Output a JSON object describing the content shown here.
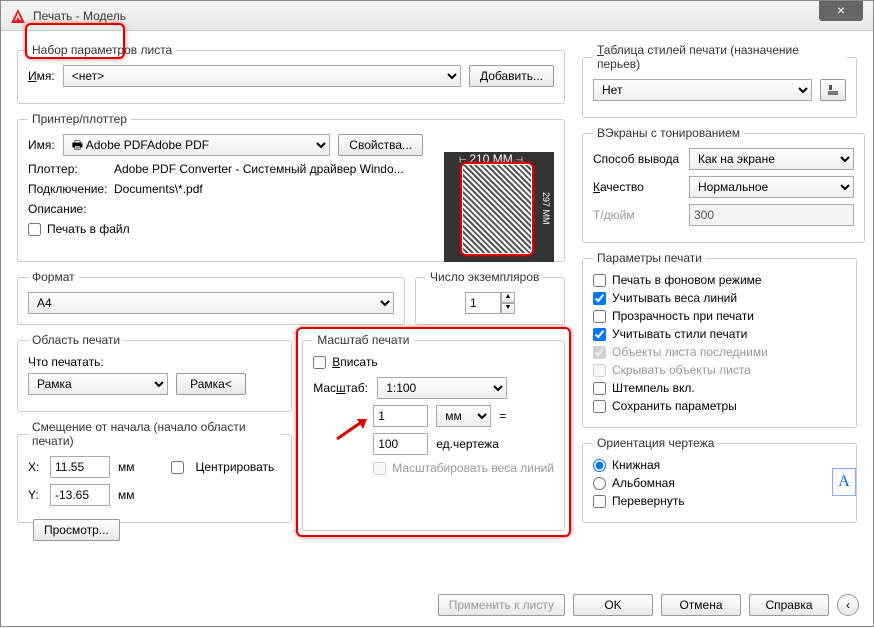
{
  "window": {
    "title": "Печать - Модель"
  },
  "pageSetup": {
    "legend": "Набор параметров листа",
    "nameLabel": "Имя:",
    "nameValue": "<нет>",
    "addBtn": "Добавить..."
  },
  "printer": {
    "legend": "Принтер/плоттер",
    "nameLabel": "Имя:",
    "nameValue": "Adobe PDF",
    "propsBtn": "Свойства...",
    "plotterLabel": "Плоттер:",
    "plotterValue": "Adobe PDF Converter - Системный драйвер Windo...",
    "connLabel": "Подключение:",
    "connValue": "Documents\\*.pdf",
    "descLabel": "Описание:",
    "toFileLabel": "Печать в файл",
    "paperW": "210 MM",
    "paperH": "297 MM"
  },
  "format": {
    "legend": "Формат",
    "value": "A4"
  },
  "copies": {
    "legend": "Число экземпляров",
    "value": "1"
  },
  "area": {
    "legend": "Область печати",
    "whatLabel": "Что печатать:",
    "whatValue": "Рамка",
    "frameBtn": "Рамка<"
  },
  "offset": {
    "legend": "Смещение от начала (начало области печати)",
    "xLabel": "X:",
    "xValue": "11.55",
    "yLabel": "Y:",
    "yValue": "-13.65",
    "unit": "мм",
    "centerLabel": "Центрировать"
  },
  "scale": {
    "legend": "Масштаб печати",
    "fitLabel": "Вписать",
    "scaleLabel": "Масштаб:",
    "scaleValue": "1:100",
    "mmValue": "1",
    "mmUnit": "мм",
    "equals": "=",
    "unitsValue": "100",
    "unitsLabel": "ед.чертежа",
    "scaleLwLabel": "Масштабировать веса линий"
  },
  "styleTable": {
    "legend": "Таблица стилей печати (назначение перьев)",
    "value": "Нет"
  },
  "shaded": {
    "legend": "ВЭкраны с тонированием",
    "modeLabel": "Способ вывода",
    "modeValue": "Как на экране",
    "qualityLabel": "Качество",
    "qualityValue": "Нормальное",
    "dpiLabel": "Т/дюйм",
    "dpiValue": "300"
  },
  "options": {
    "legend": "Параметры печати",
    "bg": "Печать в фоновом режиме",
    "lw": "Учитывать веса линий",
    "transp": "Прозрачность при печати",
    "styles": "Учитывать стили печати",
    "paperspace": "Объекты листа последними",
    "hide": "Скрывать объекты листа",
    "stamp": "Штемпель вкл.",
    "save": "Сохранить параметры"
  },
  "orient": {
    "legend": "Ориентация чертежа",
    "portrait": "Книжная",
    "landscape": "Альбомная",
    "upside": "Перевернуть"
  },
  "buttons": {
    "preview": "Просмотр...",
    "apply": "Применить к листу",
    "ok": "OK",
    "cancel": "Отмена",
    "help": "Справка"
  }
}
